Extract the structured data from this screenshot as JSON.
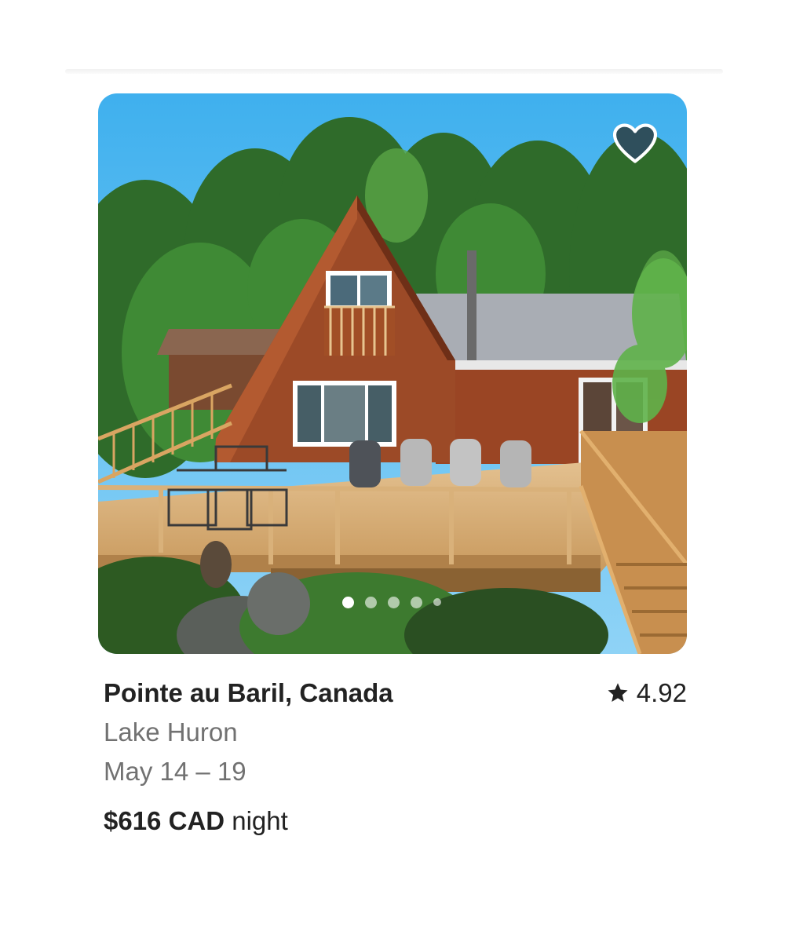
{
  "listing": {
    "location": "Pointe au Baril, Canada",
    "subtitle": "Lake Huron",
    "dates": "May 14 – 19",
    "price_amount": "$616 CAD",
    "price_unit": "night",
    "rating": "4.92"
  },
  "photo": {
    "description_icon": "a-frame-cabin-photo",
    "carousel_dots": 5,
    "active_dot": 1
  },
  "favorite": {
    "icon": "heart-icon",
    "fill": "#2f4f5c"
  },
  "colors": {
    "text_primary": "#222222",
    "text_secondary": "#717171"
  }
}
